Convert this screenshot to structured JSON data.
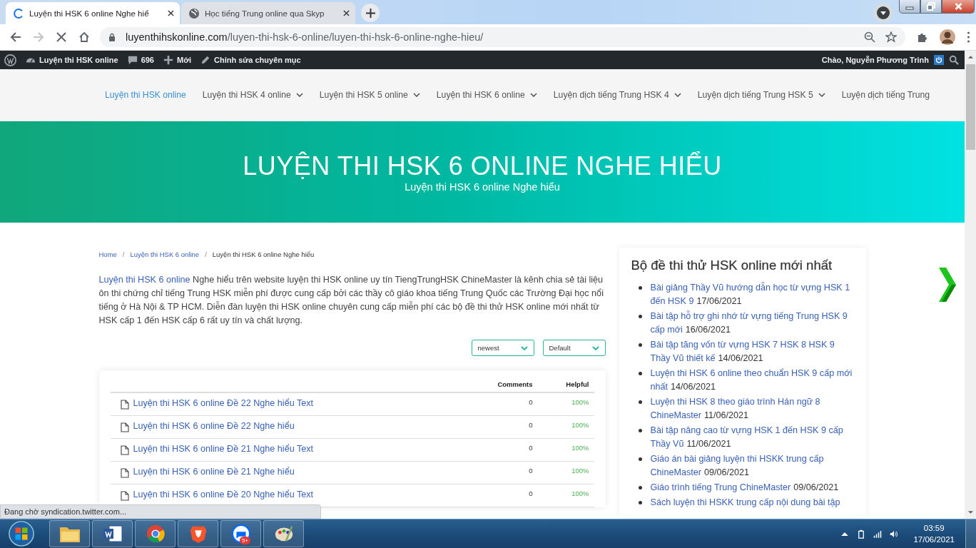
{
  "browser": {
    "tabs": [
      {
        "title": "Luyện thi HSK 6 online Nghe hiể",
        "selected": true,
        "loading": true
      },
      {
        "title": "Học tiếng Trung online qua Skyp",
        "selected": false,
        "loading": false
      }
    ],
    "forward_disabled": true,
    "url": {
      "host": "luyenthihskonline.com",
      "path": "/luyen-thi-hsk-6-online/luyen-thi-hsk-6-online-nghe-hieu/"
    }
  },
  "admin_bar": {
    "site": "Luyện thi HSK online",
    "comments": "696",
    "new": "Mới",
    "edit": "Chỉnh sửa chuyên mục",
    "greeting": "Chào, Nguyễn Phương Trinh"
  },
  "nav": [
    {
      "label": "Luyện thi HSK online",
      "selected": true,
      "dropdown": false
    },
    {
      "label": "Luyện thi HSK 4 online",
      "selected": false,
      "dropdown": true
    },
    {
      "label": "Luyện thi HSK 5 online",
      "selected": false,
      "dropdown": true
    },
    {
      "label": "Luyện thi HSK 6 online",
      "selected": false,
      "dropdown": true
    },
    {
      "label": "Luyện dịch tiếng Trung HSK 4",
      "selected": false,
      "dropdown": true
    },
    {
      "label": "Luyện dịch tiếng Trung HSK 5",
      "selected": false,
      "dropdown": true
    },
    {
      "label": "Luyện dịch tiếng Trung",
      "selected": false,
      "dropdown": false
    }
  ],
  "hero": {
    "title": "LUYỆN THI HSK 6 ONLINE NGHE HIỂU",
    "subtitle": "Luyện thi HSK 6 online Nghe hiểu"
  },
  "breadcrumb": [
    {
      "label": "Home",
      "kind": "link"
    },
    {
      "label": "/",
      "kind": "separator"
    },
    {
      "label": "Luyện thi HSK 6 online",
      "kind": "link"
    },
    {
      "label": "/",
      "kind": "separator"
    },
    {
      "label": "Luyện thi HSK 6 online Nghe hiểu",
      "kind": "current"
    }
  ],
  "intro": {
    "link": "Luyện thi HSK 6 online",
    "text": " Nghe hiểu trên website luyện thi HSK online uy tín TiengTrungHSK ChineMaster là kênh chia sẻ tài liệu ôn thi chứng chỉ tiếng Trung HSK miễn phí được cung cấp bởi các thầy cô giáo khoa tiếng Trung Quốc các Trường Đại học nổi tiếng ở Hà Nội & TP HCM. Diễn đàn luyện thi HSK online chuyên cung cấp miễn phí các bộ đề thi thử HSK online mới nhất từ HSK cấp 1 đến HSK cấp 6 rất uy tín và chất lượng."
  },
  "sort": [
    {
      "value": "newest"
    },
    {
      "value": "Default"
    }
  ],
  "table": {
    "columns": [
      "Comments",
      "Helpful"
    ],
    "rows": [
      {
        "title": "Luyện thi HSK 6 online Đề 22 Nghe hiểu Text",
        "comments": "0",
        "helpful": "100%"
      },
      {
        "title": "Luyện thi HSK 6 online Đề 22 Nghe hiểu",
        "comments": "0",
        "helpful": "100%"
      },
      {
        "title": "Luyện thi HSK 6 online Đề 21 Nghe hiểu Text",
        "comments": "0",
        "helpful": "100%"
      },
      {
        "title": "Luyện thi HSK 6 online Đề 21 Nghe hiểu",
        "comments": "0",
        "helpful": "100%"
      },
      {
        "title": "Luyện thi HSK 6 online Đề 20 Nghe hiểu Text",
        "comments": "0",
        "helpful": "100%"
      }
    ]
  },
  "sidebar": {
    "title": "Bộ đề thi thử HSK online mới nhất",
    "items": [
      {
        "title": "Bài giảng Thầy Vũ hướng dẫn học từ vựng HSK 1 đến HSK 9",
        "date": "17/06/2021"
      },
      {
        "title": "Bài tập hỗ trợ ghi nhớ từ vựng tiếng Trung HSK 9 cấp mới",
        "date": "16/06/2021"
      },
      {
        "title": "Bài tập tăng vốn từ vựng HSK 7 HSK 8 HSK 9 Thầy Vũ thiết kế",
        "date": "14/06/2021"
      },
      {
        "title": "Luyện thi HSK 6 online theo chuẩn HSK 9 cấp mới nhất",
        "date": "14/06/2021"
      },
      {
        "title": "Luyện thi HSK 8 theo giáo trình Hán ngữ 8 ChineMaster",
        "date": "11/06/2021"
      },
      {
        "title": "Bài tập nâng cao từ vựng HSK 1 đến HSK 9 cấp Thầy Vũ",
        "date": "11/06/2021"
      },
      {
        "title": "Giáo án bài giảng luyện thi HSKK trung cấp ChineMaster",
        "date": "09/06/2021"
      },
      {
        "title": "Giáo trình tiếng Trung ChineMaster",
        "date": "09/06/2021"
      },
      {
        "title": "Sách luyện thi HSKK trung cấp nội dung bài tập"
      }
    ]
  },
  "status_bubble": "Đang chờ syndication.twitter.com...",
  "taskbar": {
    "apps": [
      {
        "kind": "folder",
        "selected": false
      },
      {
        "kind": "document",
        "selected": false
      },
      {
        "kind": "browser",
        "selected": false
      },
      {
        "kind": "shield",
        "selected": false
      },
      {
        "kind": "chat",
        "selected": false,
        "badge": "5+"
      },
      {
        "kind": "palette",
        "selected": false
      }
    ],
    "time": "03:59",
    "date": "17/06/2021"
  }
}
